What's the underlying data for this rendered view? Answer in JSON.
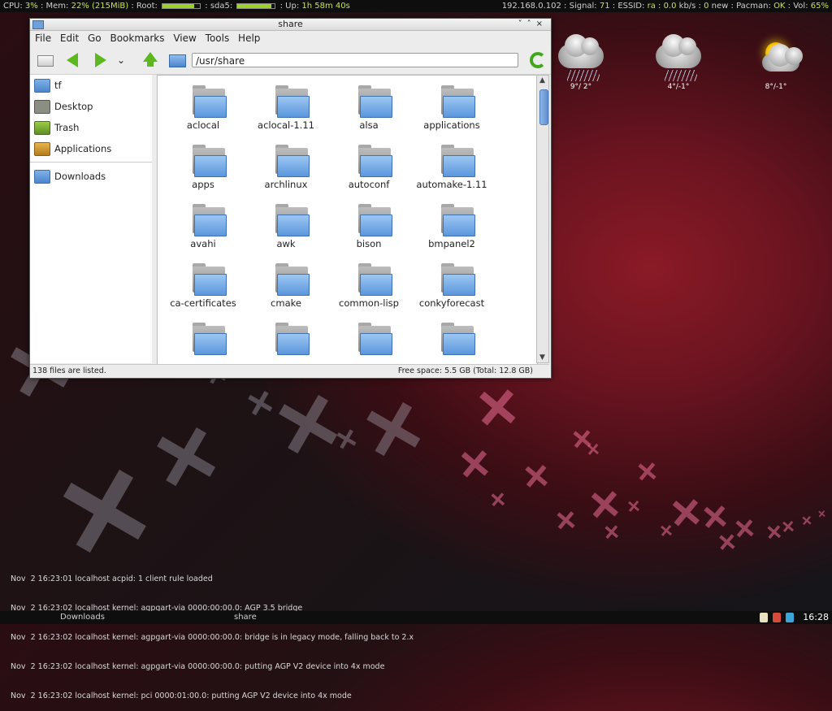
{
  "topbar": {
    "cpu_label": "CPU:",
    "cpu_value": "3%",
    "mem_label": "Mem:",
    "mem_value": "22% (215MiB)",
    "root_label": "Root:",
    "root_percent": 0.85,
    "sda5_label": "sda5:",
    "sda5_percent": 0.9,
    "up_label": "Up:",
    "up_value": "1h 58m 40s",
    "ip": "192.168.0.102",
    "signal_label": "Signal:",
    "signal_value": "71",
    "essid_label": "ESSID:",
    "essid_value": "ra",
    "net_value": "0.0",
    "net_unit": "kb/s",
    "new_count": "0",
    "new_label": "new",
    "pacman_label": "Pacman:",
    "pacman_value": "OK",
    "vol_label": "Vol:",
    "vol_value": "65%"
  },
  "weather": [
    {
      "icon": "rain-cloud-icon",
      "temp": "9°/ 2°"
    },
    {
      "icon": "rain-cloud-icon",
      "temp": "4°/-1°"
    },
    {
      "icon": "sun-cloud-icon",
      "temp": "8°/-1°"
    }
  ],
  "window": {
    "title": "share",
    "controls": "˅˄×",
    "menu": [
      "File",
      "Edit",
      "Go",
      "Bookmarks",
      "View",
      "Tools",
      "Help"
    ],
    "path": "/usr/share",
    "sidebar": [
      {
        "label": "tf",
        "icon": "home-folder-icon"
      },
      {
        "label": "Desktop",
        "icon": "desktop-icon"
      },
      {
        "label": "Trash",
        "icon": "trash-icon"
      },
      {
        "label": "Applications",
        "icon": "applications-icon"
      },
      {
        "label": "Downloads",
        "icon": "folder-icon"
      }
    ],
    "files": [
      "aclocal",
      "aclocal-1.11",
      "alsa",
      "applications",
      "apps",
      "archlinux",
      "autoconf",
      "automake-1.11",
      "avahi",
      "awk",
      "bison",
      "bmpanel2",
      "ca-certificates",
      "cmake",
      "common-lisp",
      "conkyforecast",
      "",
      "",
      "",
      ""
    ],
    "status_left": "138 files are listed.",
    "status_right": "Free space: 5.5 GB (Total: 12.8 GB)"
  },
  "log": [
    "Nov  2 16:23:01 localhost acpid: 1 client rule loaded",
    "Nov  2 16:23:02 localhost kernel: agpgart-via 0000:00:00.0: AGP 3.5 bridge",
    "Nov  2 16:23:02 localhost kernel: agpgart-via 0000:00:00.0: bridge is in legacy mode, falling back to 2.x",
    "Nov  2 16:23:02 localhost kernel: agpgart-via 0000:00:00.0: putting AGP V2 device into 4x mode",
    "Nov  2 16:23:02 localhost kernel: pci 0000:01:00.0: putting AGP V2 device into 4x mode"
  ],
  "taskbar": {
    "task1": "Downloads",
    "task2": "share",
    "clock": "16:28"
  }
}
